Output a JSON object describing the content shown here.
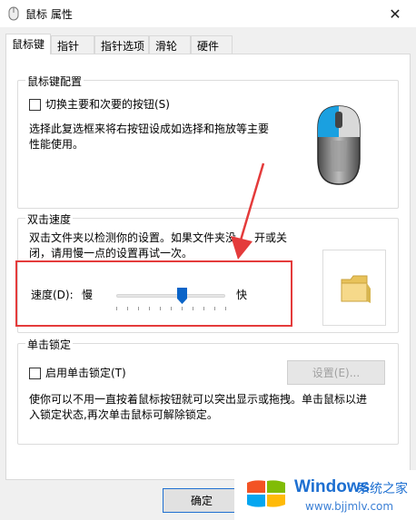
{
  "window": {
    "title": "鼠标 属性",
    "close_glyph": "✕"
  },
  "tabs": [
    {
      "label": "鼠标键"
    },
    {
      "label": "指针"
    },
    {
      "label": "指针选项"
    },
    {
      "label": "滑轮"
    },
    {
      "label": "硬件"
    }
  ],
  "button_config": {
    "title": "鼠标键配置",
    "checkbox_label": "切换主要和次要的按钮(S)",
    "checked": false,
    "description_line1": "选择此复选框来将右按钮设成如选择和拖放等主要",
    "description_line2": "性能使用。"
  },
  "double_click": {
    "title": "双击速度",
    "description_line1": "双击文件夹以检测你的设置。如果文件夹没",
    "description_line1b": "开或关",
    "description_line2": "闭，请用慢一点的设置再试一次。",
    "speed_label": "速度(D):",
    "slow_label": "慢",
    "fast_label": "快",
    "slider_value": 0.6
  },
  "click_lock": {
    "title": "单击锁定",
    "checkbox_label": "启用单击锁定(T)",
    "checked": false,
    "settings_button": "设置(E)...",
    "description_line1": "使你可以不用一直按着鼠标按钮就可以突出显示或拖拽。单击鼠标以进",
    "description_line2": "入锁定状态,再次单击鼠标可解除锁定。"
  },
  "footer": {
    "ok_button": "确定"
  },
  "watermark": {
    "brand": "Windows",
    "cn": "系统之家",
    "url": "www.bjjmlv.com"
  },
  "colors": {
    "highlight": "#e43b3b",
    "accent": "#1f6fd1"
  }
}
